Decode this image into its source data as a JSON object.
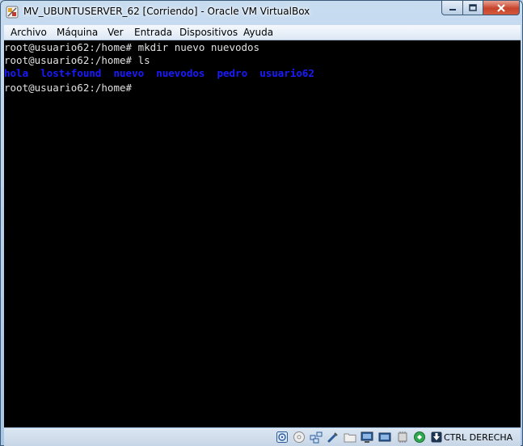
{
  "window": {
    "title": "MV_UBUNTUSERVER_62 [Corriendo] - Oracle VM VirtualBox"
  },
  "menu": {
    "items": [
      "Archivo",
      "Máquina",
      "Ver",
      "Entrada",
      "Dispositivos",
      "Ayuda"
    ]
  },
  "terminal": {
    "line1": "root@usuario62:/home# mkdir nuevo nuevodos",
    "line2": "root@usuario62:/home# ls",
    "ls_output": [
      "hola",
      "lost+found",
      "nuevo",
      "nuevodos",
      "pedro",
      "usuario62"
    ],
    "line4": "root@usuario62:/home# "
  },
  "statusbar": {
    "host_key": "CTRL DERECHA",
    "icons": [
      "hard-disk-icon",
      "optical-drive-icon",
      "network-icon",
      "usb-icon",
      "shared-folders-icon",
      "display-icon",
      "video-capture-icon",
      "cpu-icon",
      "mouse-integration-icon",
      "keyboard-arrow-icon"
    ]
  },
  "colors": {
    "terminal_bg": "#000000",
    "terminal_fg": "#e0e0e0",
    "ls_dir": "#1a1aff",
    "close_button": "#c7442b"
  }
}
